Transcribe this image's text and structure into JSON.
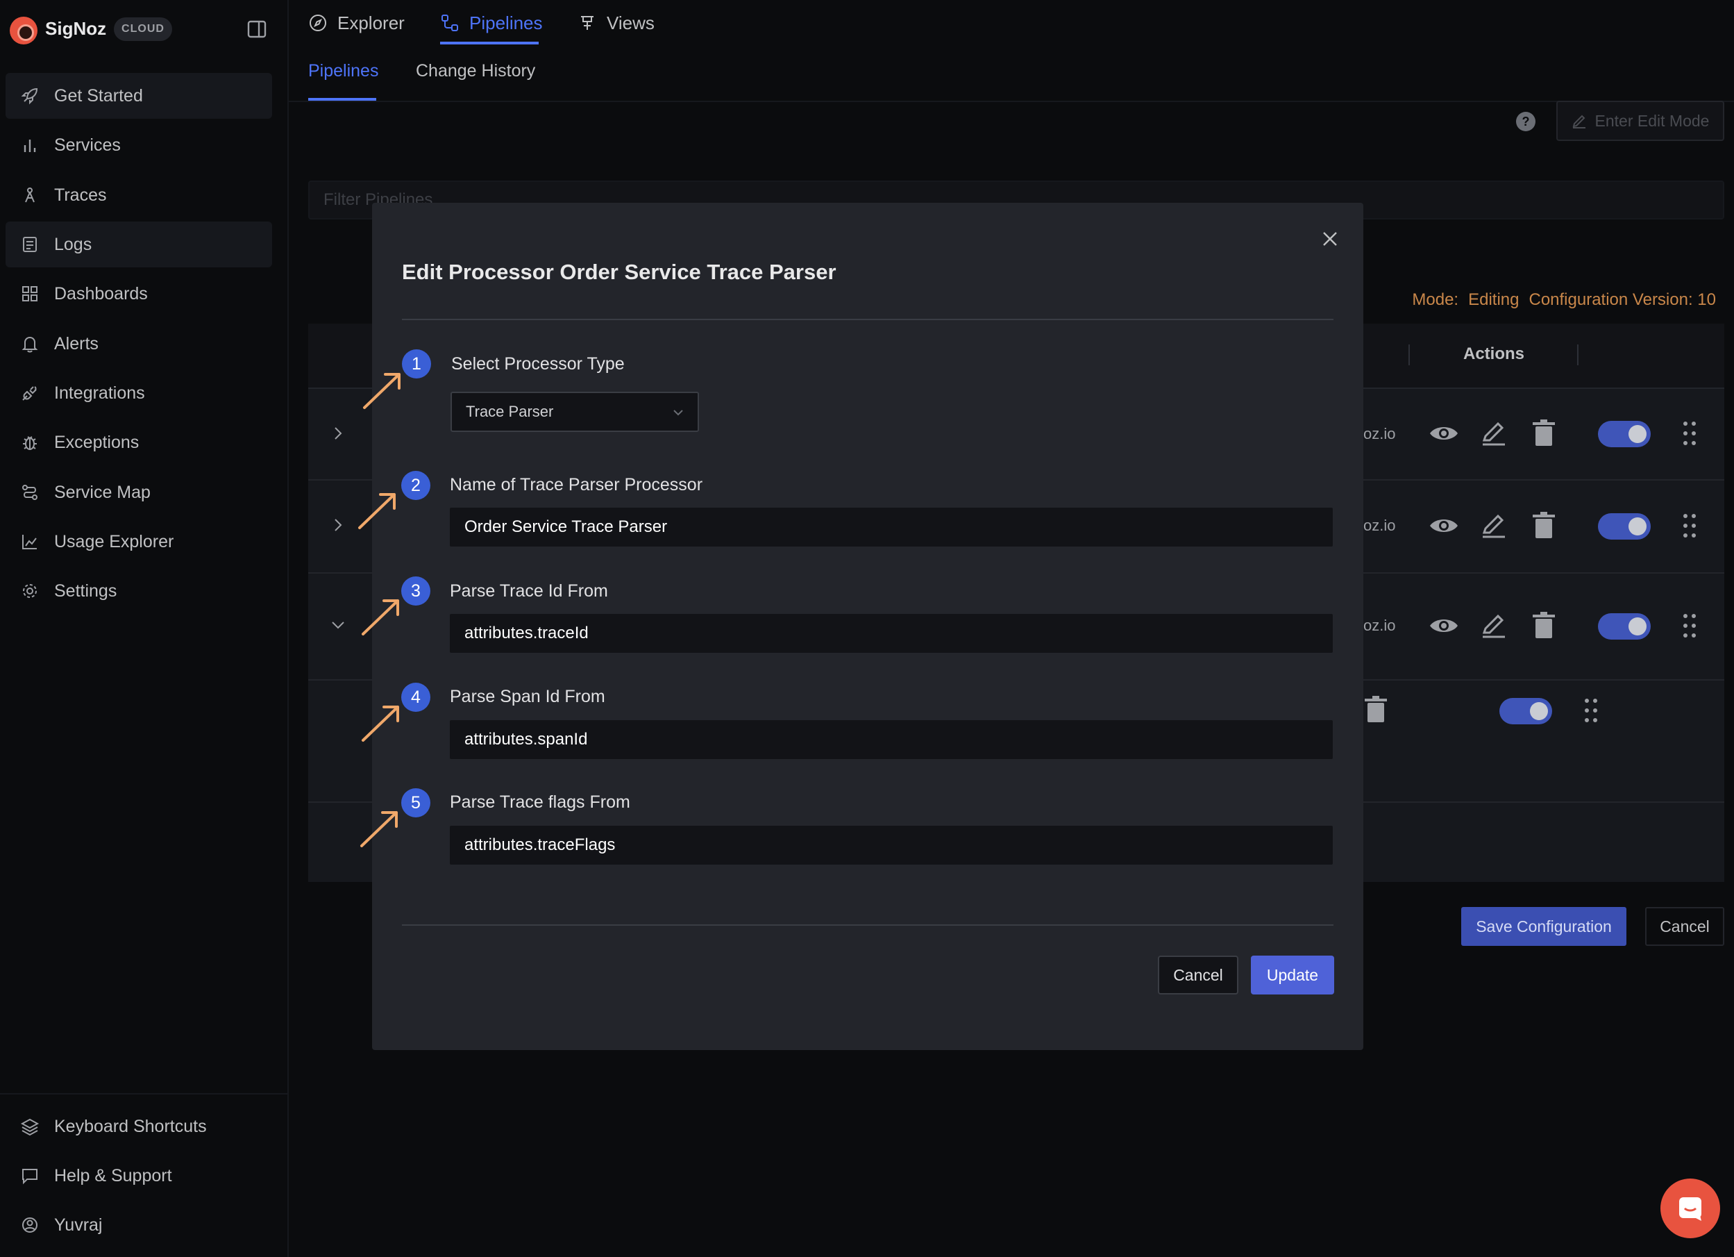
{
  "brand": {
    "name": "SigNoz",
    "badge": "CLOUD"
  },
  "sidebar": {
    "items": [
      {
        "label": "Get Started",
        "icon": "rocket-icon"
      },
      {
        "label": "Services",
        "icon": "bar-chart-icon"
      },
      {
        "label": "Traces",
        "icon": "traces-icon"
      },
      {
        "label": "Logs",
        "icon": "logs-icon"
      },
      {
        "label": "Dashboards",
        "icon": "dashboard-icon"
      },
      {
        "label": "Alerts",
        "icon": "bell-icon"
      },
      {
        "label": "Integrations",
        "icon": "plug-icon"
      },
      {
        "label": "Exceptions",
        "icon": "bug-icon"
      },
      {
        "label": "Service Map",
        "icon": "route-icon"
      },
      {
        "label": "Usage Explorer",
        "icon": "line-chart-icon"
      },
      {
        "label": "Settings",
        "icon": "gear-icon"
      }
    ],
    "bottom": [
      {
        "label": "Keyboard Shortcuts",
        "icon": "layers-icon"
      },
      {
        "label": "Help & Support",
        "icon": "message-icon"
      },
      {
        "label": "Yuvraj",
        "icon": "user-icon"
      }
    ]
  },
  "top_tabs": [
    "Explorer",
    "Pipelines",
    "Views"
  ],
  "sub_tabs": [
    "Pipelines",
    "Change History"
  ],
  "toolbar": {
    "edit_mode_label": "Enter Edit Mode"
  },
  "filter": {
    "placeholder": "Filter Pipelines"
  },
  "mode": {
    "label": "Mode:",
    "value": "Editing",
    "version_label": "Configuration Version: 10"
  },
  "table": {
    "actions_header": "Actions",
    "row_host": "oz.io"
  },
  "footer_buttons": {
    "save": "Save Configuration",
    "cancel": "Cancel"
  },
  "modal": {
    "title": "Edit Processor Order Service Trace Parser",
    "steps": [
      {
        "number": "1",
        "label": "Select Processor Type",
        "value": "Trace Parser"
      },
      {
        "number": "2",
        "label": "Name of Trace Parser Processor",
        "value": "Order Service Trace Parser"
      },
      {
        "number": "3",
        "label": "Parse Trace Id From",
        "value": "attributes.traceId"
      },
      {
        "number": "4",
        "label": "Parse Span Id From",
        "value": "attributes.spanId"
      },
      {
        "number": "5",
        "label": "Parse Trace flags From",
        "value": "attributes.traceFlags"
      }
    ],
    "cancel_label": "Cancel",
    "update_label": "Update"
  },
  "colors": {
    "accent": "#4e74f8",
    "step_badge": "#3a5fd6",
    "annotation_arrow": "#f0a86a",
    "mode_text": "#c9874a",
    "update_button": "#4f62d8",
    "brand": "#e8533f"
  }
}
